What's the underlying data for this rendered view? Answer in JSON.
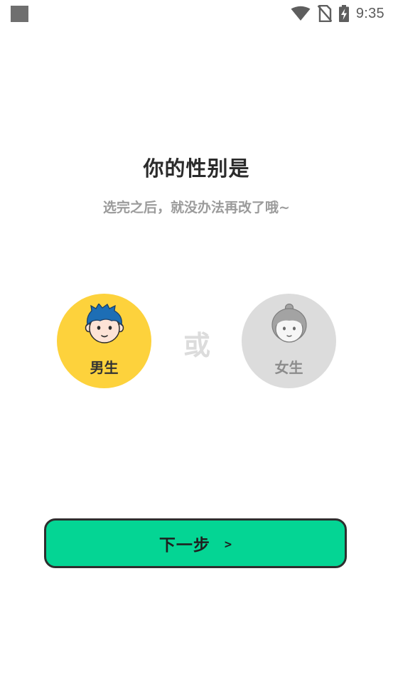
{
  "status_bar": {
    "time": "9:35",
    "icons": [
      "notification-square-icon",
      "wifi-icon",
      "no-sim-icon",
      "battery-charging-icon"
    ]
  },
  "header": {
    "title": "你的性别是",
    "subtitle": "选完之后，就没办法再改了哦~"
  },
  "gender": {
    "male": {
      "label": "男生",
      "selected": true,
      "color": "#fdd23c"
    },
    "separator": "或",
    "female": {
      "label": "女生",
      "selected": false,
      "color": "#dcdcdc"
    }
  },
  "next_button": {
    "label": "下一步",
    "arrow": ">",
    "color": "#04d594"
  }
}
